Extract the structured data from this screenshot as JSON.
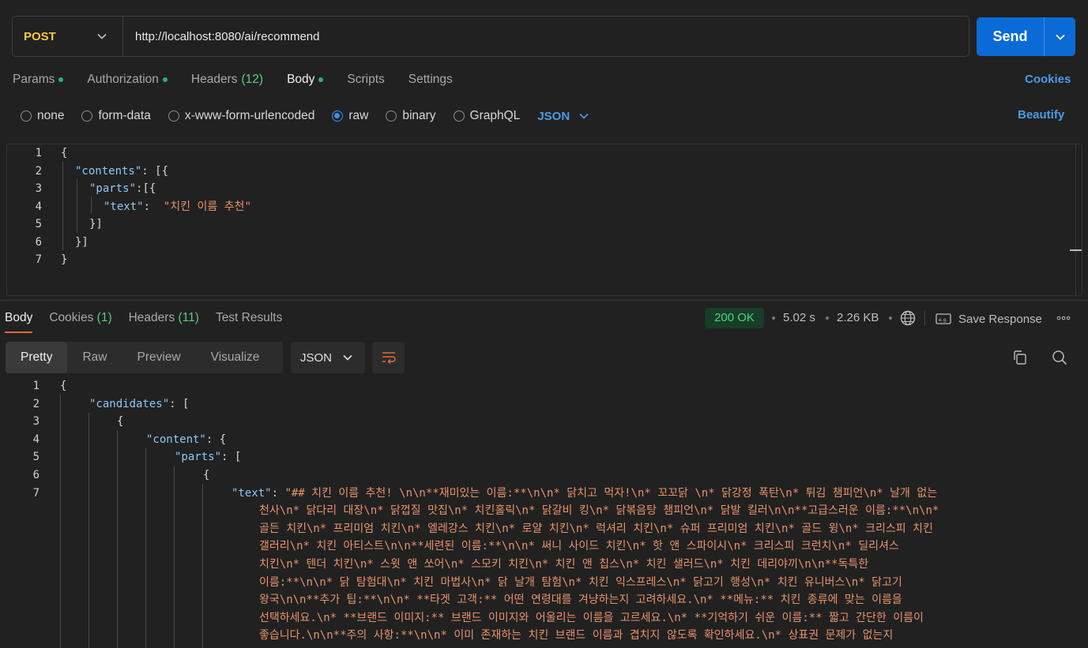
{
  "request": {
    "method": "POST",
    "url": "http://localhost:8080/ai/recommend",
    "send_label": "Send"
  },
  "request_tabs": [
    {
      "label": "Params",
      "dot": true
    },
    {
      "label": "Authorization",
      "dot": true
    },
    {
      "label": "Headers",
      "count": "(12)"
    },
    {
      "label": "Body",
      "dot": true,
      "active": true
    },
    {
      "label": "Scripts"
    },
    {
      "label": "Settings"
    }
  ],
  "cookies_label": "Cookies",
  "body_types": [
    "none",
    "form-data",
    "x-www-form-urlencoded",
    "raw",
    "binary",
    "GraphQL"
  ],
  "body_type_selected": "raw",
  "body_format": "JSON",
  "beautify_label": "Beautify",
  "request_body": {
    "line_numbers": [
      "1",
      "2",
      "3",
      "4",
      "5",
      "6",
      "7"
    ],
    "k_contents": "\"contents\"",
    "k_parts": "\"parts\"",
    "k_text": "\"text\"",
    "v_text": "\"치킨 이름 추천\""
  },
  "response_tabs": [
    {
      "label": "Body",
      "active": true
    },
    {
      "label": "Cookies",
      "count": "(1)"
    },
    {
      "label": "Headers",
      "count": "(11)"
    },
    {
      "label": "Test Results"
    }
  ],
  "response_meta": {
    "status": "200 OK",
    "time": "5.02 s",
    "size": "2.26 KB",
    "save_label": "Save Response"
  },
  "view_modes": [
    "Pretty",
    "Raw",
    "Preview",
    "Visualize"
  ],
  "response_format": "JSON",
  "response_body": {
    "line_numbers": [
      "1",
      "2",
      "3",
      "4",
      "5",
      "6",
      "7"
    ],
    "k_candidates": "\"candidates\"",
    "k_content": "\"content\"",
    "k_parts": "\"parts\"",
    "k_text": "\"text\"",
    "text_lines": [
      "\"## 치킨 이름 추천! \\n\\n**재미있는 이름:**\\n\\n* 닭치고 먹자!\\n* 꼬꼬닭 \\n* 닭강정 폭탄\\n* 튀김 챔피언\\n* 날개 없는",
      "천사\\n* 닭다리 대장\\n* 닭껍질 맛집\\n* 치킨홀릭\\n* 닭갈비 킹\\n* 닭볶음탕 챔피언\\n* 닭발 킬러\\n\\n**고급스러운 이름:**\\n\\n*",
      "골든 치킨\\n* 프리미엄 치킨\\n* 엘레강스 치킨\\n* 로얄 치킨\\n* 럭셔리 치킨\\n* 슈퍼 프리미엄 치킨\\n* 골드 윙\\n* 크리스피 치킨",
      "갤러리\\n* 치킨 아티스트\\n\\n**세련된 이름:**\\n\\n* 써니 사이드 치킨\\n* 핫 앤 스파이시\\n* 크리스피 크런치\\n* 딜리셔스",
      "치킨\\n* 텐더 치킨\\n* 스윗 앤 쏘어\\n* 스모키 치킨\\n* 치킨 앤 칩스\\n* 치킨 샐러드\\n* 치킨 데리야끼\\n\\n**독특한",
      "이름:**\\n\\n* 닭 탐험대\\n* 치킨 마법사\\n* 닭 날개 탐험\\n* 치킨 익스프레스\\n* 닭고기 행성\\n* 치킨 유니버스\\n* 닭고기",
      "왕국\\n\\n**추가 팁:**\\n\\n* **타겟 고객:** 어떤 연령대를 겨냥하는지 고려하세요.\\n* **메뉴:** 치킨 종류에 맞는 이름을",
      "선택하세요.\\n* **브랜드 이미지:** 브랜드 이미지와 어울리는 이름을 고르세요.\\n* **기억하기 쉬운 이름:** 짧고 간단한 이름이",
      "좋습니다.\\n\\n**주의 사항:**\\n\\n* 이미 존재하는 치킨 브랜드 이름과 겹치지 않도록 확인하세요.\\n* 상표권 문제가 없는지"
    ]
  }
}
